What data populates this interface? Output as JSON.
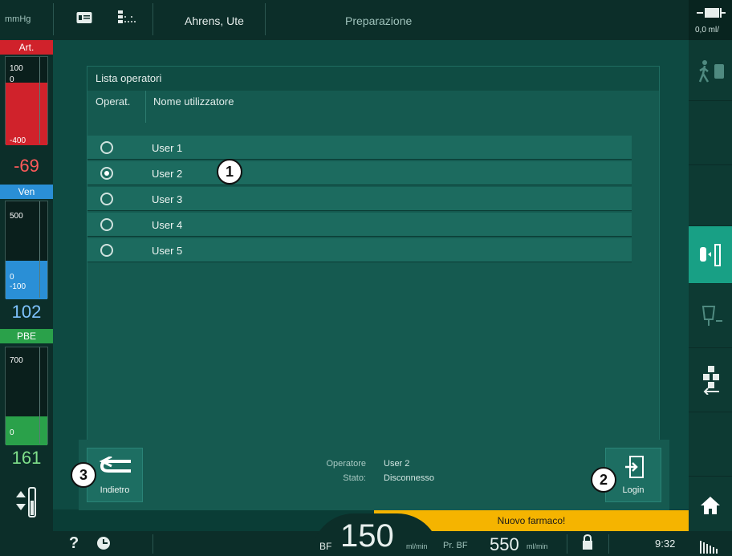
{
  "topbar": {
    "unit": "mmHg",
    "patient_name": "Ahrens, Ute",
    "mode": "Preparazione",
    "right_value": "0,0 ml/"
  },
  "left": {
    "art": {
      "label": "Art.",
      "scale_top": "100",
      "scale_zero": "0",
      "scale_bottom": "-400",
      "value": "-69",
      "color": "#d0222b"
    },
    "ven": {
      "label": "Ven",
      "scale_top": "500",
      "scale_zero": "0",
      "scale_bottom": "-100",
      "value": "102",
      "color": "#2a8fd6"
    },
    "pbe": {
      "label": "PBE",
      "scale_top": "700",
      "scale_zero": "0",
      "value": "161",
      "color": "#2aa14a"
    }
  },
  "list": {
    "title": "Lista operatori",
    "col_operat": "Operat.",
    "col_nome": "Nome utilizzatore",
    "users": [
      {
        "name": "User 1",
        "selected": false
      },
      {
        "name": "User 2",
        "selected": true
      },
      {
        "name": "User 3",
        "selected": false
      },
      {
        "name": "User 4",
        "selected": false
      },
      {
        "name": "User 5",
        "selected": false
      }
    ]
  },
  "actions": {
    "back_label": "Indietro",
    "login_label": "Login",
    "operator_key": "Operatore",
    "operator_value": "User 2",
    "state_key": "Stato:",
    "state_value": "Disconnesso"
  },
  "callouts": {
    "c1": "1",
    "c2": "2",
    "c3": "3"
  },
  "notification": "Nuovo farmaco!",
  "bottombar": {
    "help": "?",
    "bf_label": "BF",
    "bf_value": "150",
    "bf_unit": "ml/min",
    "prbf_label": "Pr. BF",
    "prbf_value": "550",
    "prbf_unit": "ml/min",
    "time": "9:32"
  },
  "colors": {
    "accent": "#18a085",
    "notify": "#f5b400"
  }
}
